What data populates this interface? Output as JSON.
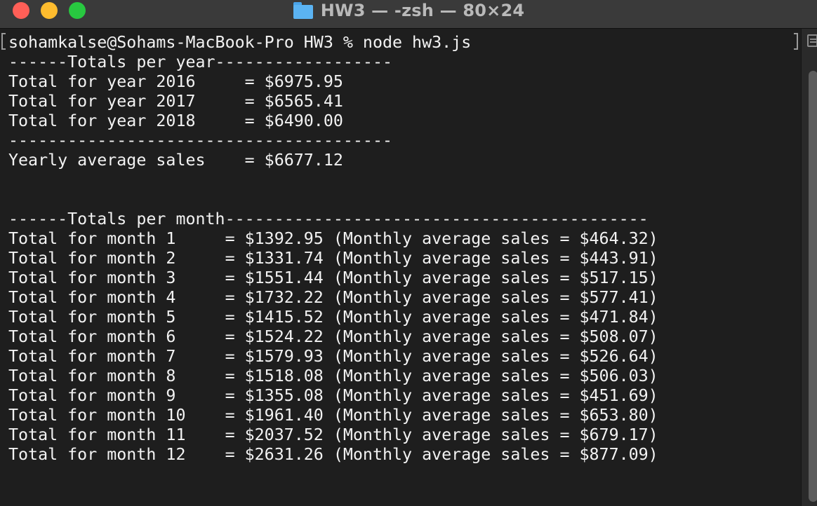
{
  "window": {
    "title": "HW3 — -zsh — 80×24"
  },
  "terminal": {
    "lines": [
      "sohamkalse@Sohams-MacBook-Pro HW3 % node hw3.js",
      "------Totals per year------------------",
      "Total for year 2016     = $6975.95",
      "Total for year 2017     = $6565.41",
      "Total for year 2018     = $6490.00",
      "---------------------------------------",
      "Yearly average sales    = $6677.12",
      "",
      "",
      "------Totals per month-------------------------------------------",
      "Total for month 1     = $1392.95 (Monthly average sales = $464.32)",
      "Total for month 2     = $1331.74 (Monthly average sales = $443.91)",
      "Total for month 3     = $1551.44 (Monthly average sales = $517.15)",
      "Total for month 4     = $1732.22 (Monthly average sales = $577.41)",
      "Total for month 5     = $1415.52 (Monthly average sales = $471.84)",
      "Total for month 6     = $1524.22 (Monthly average sales = $508.07)",
      "Total for month 7     = $1579.93 (Monthly average sales = $526.64)",
      "Total for month 8     = $1518.08 (Monthly average sales = $506.03)",
      "Total for month 9     = $1355.08 (Monthly average sales = $451.69)",
      "Total for month 10    = $1961.40 (Monthly average sales = $653.80)",
      "Total for month 11    = $2037.52 (Monthly average sales = $679.17)",
      "Total for month 12    = $2631.26 (Monthly average sales = $877.09)"
    ]
  },
  "icons": {
    "close": "close-button-icon",
    "minimize": "minimize-button-icon",
    "maximize": "maximize-button-icon",
    "folder": "folder-icon",
    "scroll_menu": "marks-menu-icon"
  },
  "colors": {
    "close": "#ff5f57",
    "minimize": "#febc2e",
    "maximize": "#28c840",
    "folder": "#5bb3f2",
    "terminal_bg": "#1e1e1e",
    "text": "#f2f2f2"
  }
}
